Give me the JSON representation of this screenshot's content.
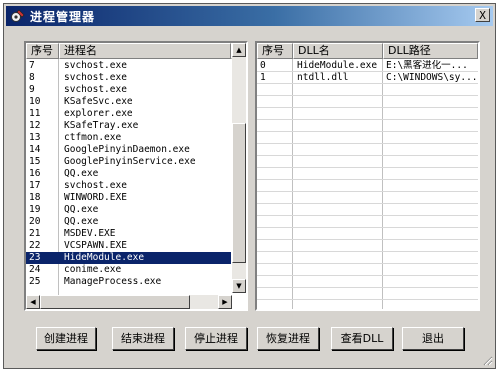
{
  "window": {
    "title": "进程管理器",
    "close_symbol": "X"
  },
  "process_list": {
    "headers": [
      "序号",
      "进程名"
    ],
    "rows": [
      [
        "7",
        "svchost.exe"
      ],
      [
        "8",
        "svchost.exe"
      ],
      [
        "9",
        "svchost.exe"
      ],
      [
        "10",
        "KSafeSvc.exe"
      ],
      [
        "11",
        "explorer.exe"
      ],
      [
        "12",
        "KSafeTray.exe"
      ],
      [
        "13",
        "ctfmon.exe"
      ],
      [
        "14",
        "GooglePinyinDaemon.exe"
      ],
      [
        "15",
        "GooglePinyinService.exe"
      ],
      [
        "16",
        "QQ.exe"
      ],
      [
        "17",
        "svchost.exe"
      ],
      [
        "18",
        "WINWORD.EXE"
      ],
      [
        "19",
        "QQ.exe"
      ],
      [
        "20",
        "QQ.exe"
      ],
      [
        "21",
        "MSDEV.EXE"
      ],
      [
        "22",
        "VCSPAWN.EXE"
      ],
      [
        "23",
        "HideModule.exe"
      ],
      [
        "24",
        "conime.exe"
      ],
      [
        "25",
        "ManageProcess.exe"
      ]
    ],
    "selected_row": "23"
  },
  "dll_list": {
    "headers": [
      "序号",
      "DLL名",
      "DLL路径"
    ],
    "rows": [
      [
        "0",
        "HideModule.exe",
        "E:\\黑客进化一..."
      ],
      [
        "1",
        "ntdll.dll",
        "C:\\WINDOWS\\sy..."
      ]
    ]
  },
  "buttons": {
    "create": "创建进程",
    "end": "结束进程",
    "stop": "停止进程",
    "resume": "恢复进程",
    "view_dll": "查看DLL",
    "exit": "退出"
  },
  "icons": {
    "app": "gear-tool-icon",
    "scroll_up": "arrow-up-icon",
    "scroll_down": "arrow-down-icon",
    "scroll_left": "arrow-left-icon",
    "scroll_right": "arrow-right-icon"
  },
  "colors": {
    "titlebar": "#0a246a",
    "selection": "#0a246a",
    "face": "#d6d3ce"
  }
}
